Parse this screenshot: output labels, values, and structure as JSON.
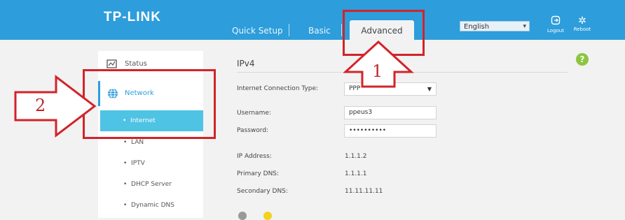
{
  "header": {
    "logo": "TP-LINK",
    "tabs": [
      {
        "label": "Quick Setup"
      },
      {
        "label": "Basic"
      },
      {
        "label": "Advanced",
        "active": true
      }
    ],
    "language": {
      "selected": "English"
    },
    "logout_label": "Logout",
    "reboot_label": "Reboot"
  },
  "sidebar": {
    "status_label": "Status",
    "network_label": "Network",
    "network_items": [
      "Internet",
      "LAN",
      "IPTV",
      "DHCP Server",
      "Dynamic DNS"
    ],
    "bullet": "•"
  },
  "main": {
    "section_title": "IPv4",
    "fields": {
      "connection_type": {
        "label": "Internet Connection Type:",
        "value": "PPP"
      },
      "username": {
        "label": "Username:",
        "value": "ppeus3"
      },
      "password": {
        "label": "Password:",
        "value": "••••••••••"
      },
      "ip_address": {
        "label": "IP Address:",
        "value": "1.1.1.2"
      },
      "primary_dns": {
        "label": "Primary DNS:",
        "value": "1.1.1.1"
      },
      "secondary_dns": {
        "label": "Secondary DNS:",
        "value": "11.11.11.11"
      }
    },
    "help_glyph": "?"
  },
  "annotations": {
    "marker_1": "1",
    "marker_2": "2",
    "color": "#d2232a"
  },
  "colors": {
    "header": "#2d9ddb",
    "active_item": "#4ec3e4",
    "help": "#8cc63f"
  }
}
